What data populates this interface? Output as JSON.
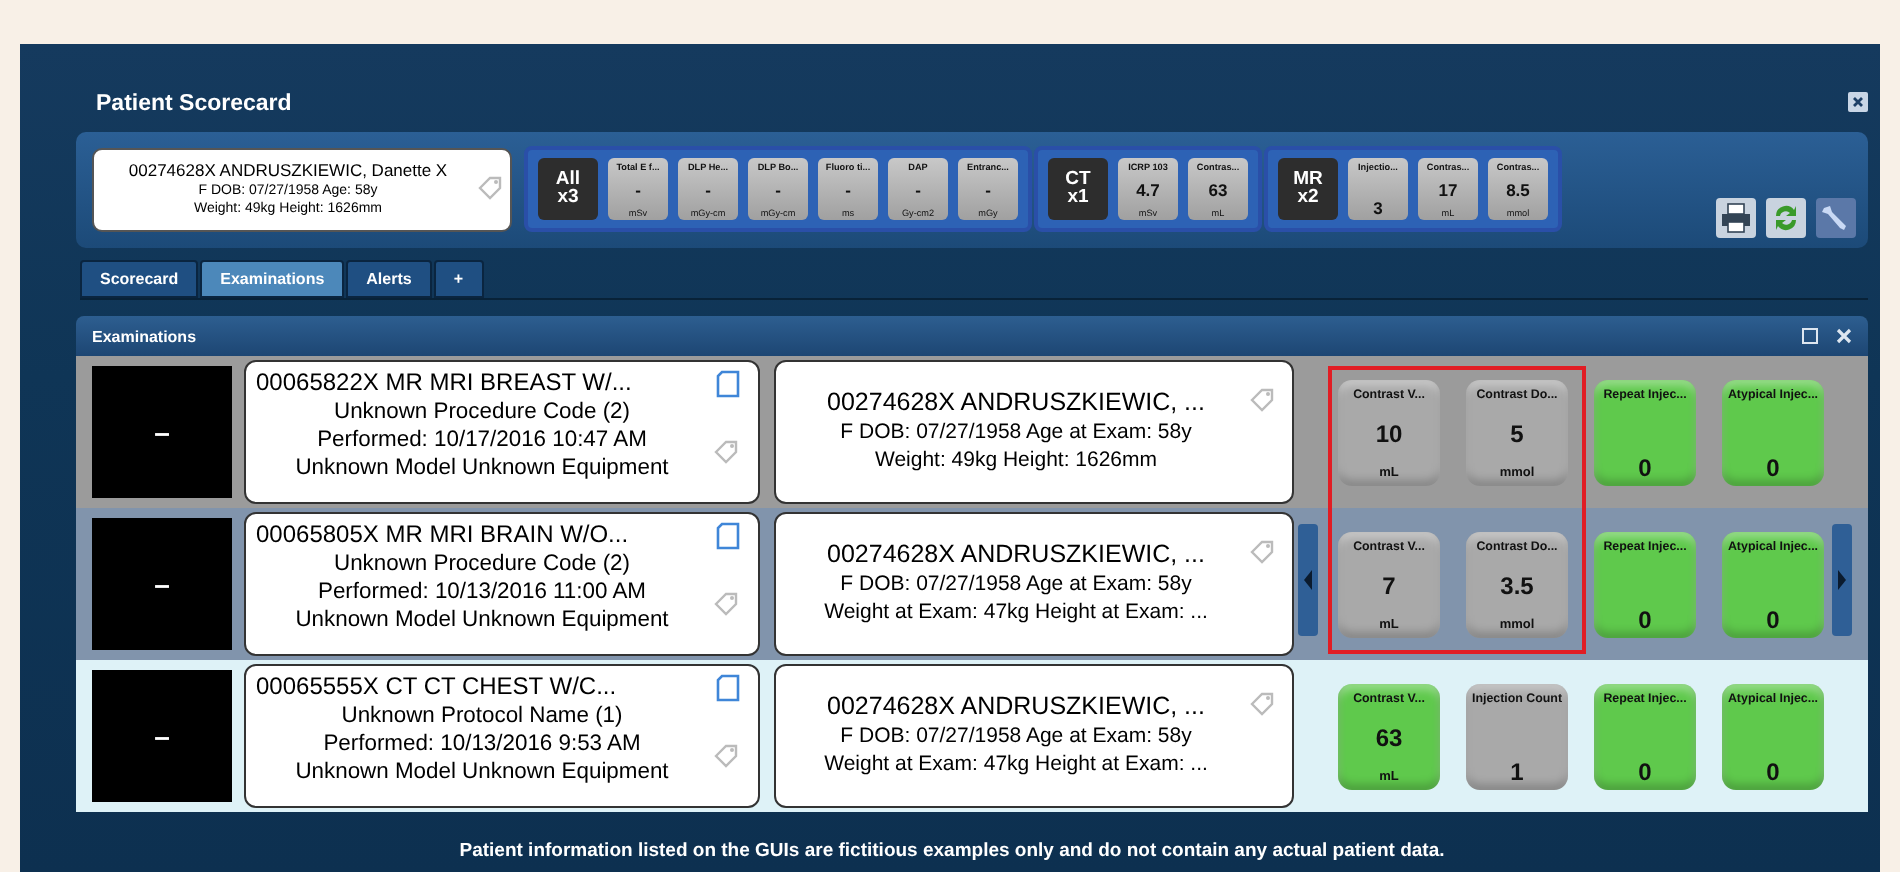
{
  "window": {
    "title": "Patient Scorecard"
  },
  "patient": {
    "line1": "00274628X  ANDRUSZKIEWIC, Danette X",
    "line2": "F  DOB: 07/27/1958  Age: 58y",
    "line3": "Weight: 49kg  Height: 1626mm"
  },
  "tile_groups": [
    {
      "tiles": [
        {
          "kind": "summary",
          "label": "All",
          "value": "x3"
        },
        {
          "kind": "metric",
          "label": "Total E f...",
          "value": "-",
          "unit": "mSv"
        },
        {
          "kind": "metric",
          "label": "DLP He...",
          "value": "-",
          "unit": "mGy-cm"
        },
        {
          "kind": "metric",
          "label": "DLP Bo...",
          "value": "-",
          "unit": "mGy-cm"
        },
        {
          "kind": "metric",
          "label": "Fluoro ti...",
          "value": "-",
          "unit": "ms"
        },
        {
          "kind": "metric",
          "label": "DAP",
          "value": "-",
          "unit": "Gy-cm2"
        },
        {
          "kind": "metric",
          "label": "Entranc...",
          "value": "-",
          "unit": "mGy"
        }
      ]
    },
    {
      "tiles": [
        {
          "kind": "summary",
          "label": "CT",
          "value": "x1"
        },
        {
          "kind": "metric",
          "label": "ICRP 103",
          "value": "4.7",
          "unit": "mSv"
        },
        {
          "kind": "metric",
          "label": "Contras...",
          "value": "63",
          "unit": "mL"
        }
      ]
    },
    {
      "tiles": [
        {
          "kind": "summary",
          "label": "MR",
          "value": "x2"
        },
        {
          "kind": "metric",
          "label": "Injectio...",
          "value": "3"
        },
        {
          "kind": "metric",
          "label": "Contras...",
          "value": "17",
          "unit": "mL"
        },
        {
          "kind": "metric",
          "label": "Contras...",
          "value": "8.5",
          "unit": "mmol"
        }
      ]
    }
  ],
  "tabs": [
    {
      "label": "Scorecard",
      "selected": false
    },
    {
      "label": "Examinations",
      "selected": true
    },
    {
      "label": "Alerts",
      "selected": false
    },
    {
      "label": "+",
      "selected": false
    }
  ],
  "examinations": {
    "title": "Examinations",
    "highlight_shown": true,
    "rows": [
      {
        "selected": false,
        "thumb": "–",
        "exam": [
          "00065822X MR MRI BREAST W/...",
          "Unknown Procedure Code (2)",
          "Performed: 10/17/2016 10:47 AM",
          "Unknown Model Unknown Equipment"
        ],
        "patient": [
          "00274628X ANDRUSZKIEWIC, ...",
          "F  DOB: 07/27/1958  Age at Exam: 58y",
          "Weight: 49kg   Height: 1626mm"
        ],
        "nav_arrows": false,
        "tiles": [
          {
            "label": "Contrast V...",
            "value": "10",
            "unit": "mL",
            "color": "#a9a9a9"
          },
          {
            "label": "Contrast Do...",
            "value": "5",
            "unit": "mmol",
            "color": "#a9a9a9"
          },
          {
            "label": "Repeat Injec...",
            "value": "0",
            "color": "#5fc94c"
          },
          {
            "label": "Atypical Injec...",
            "value": "0",
            "color": "#5fc94c"
          }
        ]
      },
      {
        "selected": false,
        "thumb": "–",
        "exam": [
          "00065805X MR MRI BRAIN W/O...",
          "Unknown Procedure Code (2)",
          "Performed: 10/13/2016 11:00 AM",
          "Unknown Model Unknown Equipment"
        ],
        "patient": [
          "00274628X ANDRUSZKIEWIC, ...",
          "F  DOB: 07/27/1958  Age at Exam: 58y",
          "Weight at Exam: 47kg   Height at Exam: ..."
        ],
        "nav_arrows": true,
        "tiles": [
          {
            "label": "Contrast V...",
            "value": "7",
            "unit": "mL",
            "color": "#a9a9a9"
          },
          {
            "label": "Contrast Do...",
            "value": "3.5",
            "unit": "mmol",
            "color": "#a9a9a9"
          },
          {
            "label": "Repeat Injec...",
            "value": "0",
            "color": "#5fc94c"
          },
          {
            "label": "Atypical Injec...",
            "value": "0",
            "color": "#5fc94c"
          }
        ]
      },
      {
        "selected": true,
        "thumb": "–",
        "exam": [
          "00065555X CT CT CHEST W/C...",
          "Unknown Protocol Name (1)",
          "Performed: 10/13/2016 9:53 AM",
          "Unknown Model Unknown Equipment"
        ],
        "patient": [
          "00274628X ANDRUSZKIEWIC, ...",
          "F  DOB: 07/27/1958  Age at Exam: 58y",
          "Weight at Exam: 47kg   Height at Exam: ..."
        ],
        "nav_arrows": false,
        "tiles": [
          {
            "label": "Contrast V...",
            "value": "63",
            "unit": "mL",
            "color": "#5fc94c"
          },
          {
            "label": "Injection Count",
            "value": "1",
            "color": "#a9a9a9"
          },
          {
            "label": "Repeat Injec...",
            "value": "0",
            "color": "#5fc94c"
          },
          {
            "label": "Atypical Injec...",
            "value": "0",
            "color": "#5fc94c"
          }
        ]
      }
    ]
  },
  "footer": "Patient information listed on the GUIs are fictitious examples only and do not contain any actual patient data."
}
